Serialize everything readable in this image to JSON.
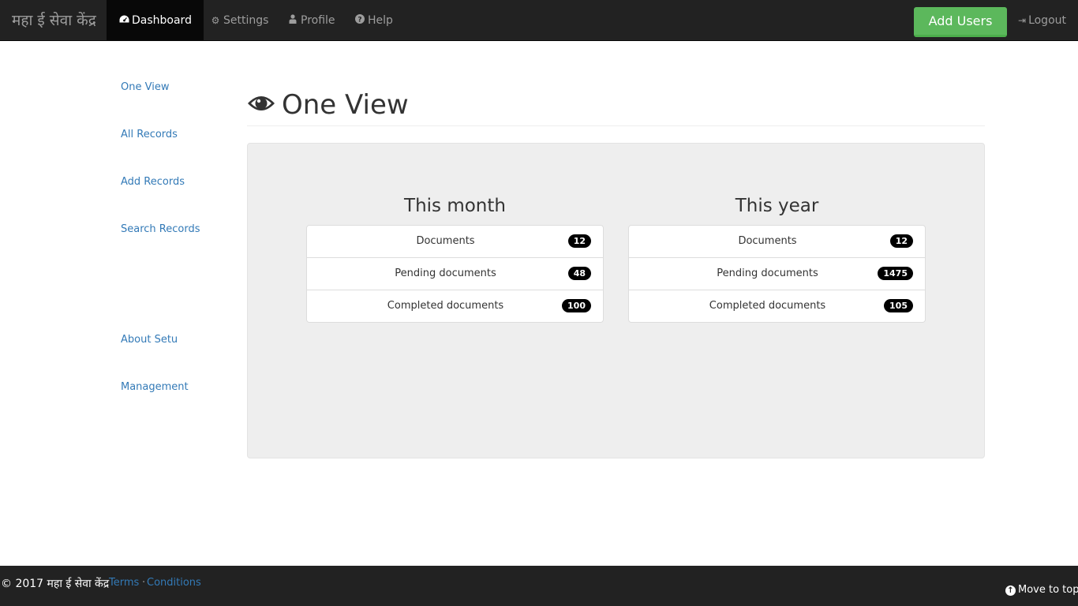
{
  "navbar": {
    "brand": "महा ई सेवा केंद्र",
    "items": [
      {
        "label": "Dashboard",
        "icon": "dashboard-icon"
      },
      {
        "label": "Settings",
        "icon": "gear-icon"
      },
      {
        "label": "Profile",
        "icon": "user-icon"
      },
      {
        "label": "Help",
        "icon": "question-icon"
      }
    ],
    "add_users_label": "Add Users",
    "logout_label": "Logout",
    "accent_color": "#5cb85c"
  },
  "sidebar": {
    "items": [
      {
        "label": "One View"
      },
      {
        "label": "All Records"
      },
      {
        "label": "Add Records"
      },
      {
        "label": "Search Records"
      },
      {
        "label": "About Setu"
      },
      {
        "label": "Management"
      }
    ]
  },
  "main": {
    "title": "One View",
    "title_icon": "eye-icon",
    "panels": [
      {
        "title": "This month",
        "rows": [
          {
            "label": "Documents",
            "count": "12"
          },
          {
            "label": "Pending documents",
            "count": "48"
          },
          {
            "label": "Completed documents",
            "count": "100"
          }
        ]
      },
      {
        "title": "This year",
        "rows": [
          {
            "label": "Documents",
            "count": "12"
          },
          {
            "label": "Pending documents",
            "count": "1475"
          },
          {
            "label": "Completed documents",
            "count": "105"
          }
        ]
      }
    ]
  },
  "footer": {
    "copyright": "© 2017 महा ई सेवा केंद्र",
    "terms_label": "Terms",
    "separator": "·",
    "conditions_label": "Conditions",
    "move_to_top_label": "Move to top",
    "move_to_top_icon": "arrow-up-circle-icon"
  }
}
